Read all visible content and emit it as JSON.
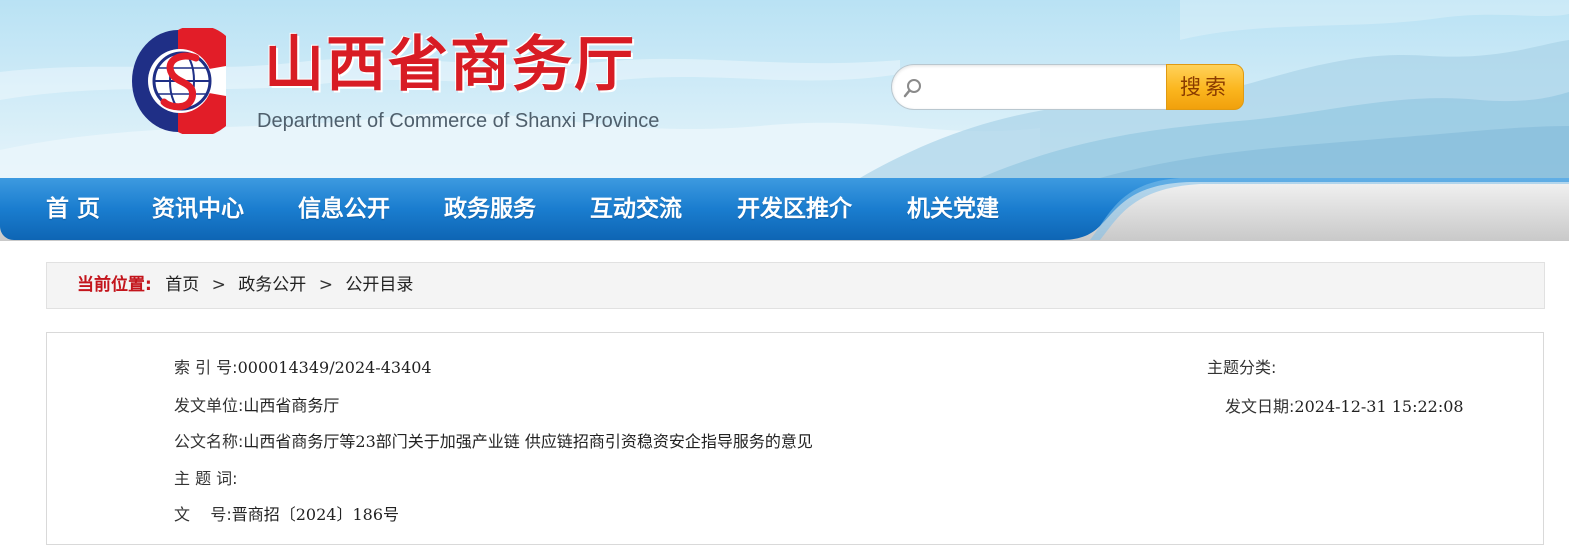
{
  "colors": {
    "title_red": "#d81c24",
    "nav_blue": "#1874c4",
    "search_button_orange": "#fbb61e",
    "breadcrumb_label_red": "#c3151c"
  },
  "header": {
    "logo_icon": "shanxi-commerce-emblem",
    "title": "山西省商务厅",
    "subtitle": "Department of Commerce of Shanxi Province",
    "search": {
      "icon": "search-icon",
      "value": "",
      "placeholder": "",
      "button_label": "搜索"
    }
  },
  "nav": {
    "items": [
      {
        "label": "首  页"
      },
      {
        "label": "资讯中心"
      },
      {
        "label": "信息公开"
      },
      {
        "label": "政务服务"
      },
      {
        "label": "互动交流"
      },
      {
        "label": "开发区推介"
      },
      {
        "label": "机关党建"
      }
    ]
  },
  "breadcrumb": {
    "label": "当前位置:",
    "items": [
      "首页",
      "政务公开",
      "公开目录"
    ],
    "separator": ">"
  },
  "meta": {
    "index_no": {
      "label": "索 引 号:",
      "value": "000014349/2024-43404"
    },
    "issuer": {
      "label": "发文单位:",
      "value": "山西省商务厅"
    },
    "doc_title": {
      "label": "公文名称:",
      "value": "山西省商务厅等23部门关于加强产业链 供应链招商引资稳资安企指导服务的意见"
    },
    "subject_words": {
      "label": "主 题 词:",
      "value": ""
    },
    "doc_no": {
      "label": "文    号:",
      "value": "晋商招〔2024〕186号"
    },
    "category": {
      "label": "主题分类:",
      "value": ""
    },
    "issue_date": {
      "label": "发文日期:",
      "value": "2024-12-31 15:22:08"
    }
  }
}
